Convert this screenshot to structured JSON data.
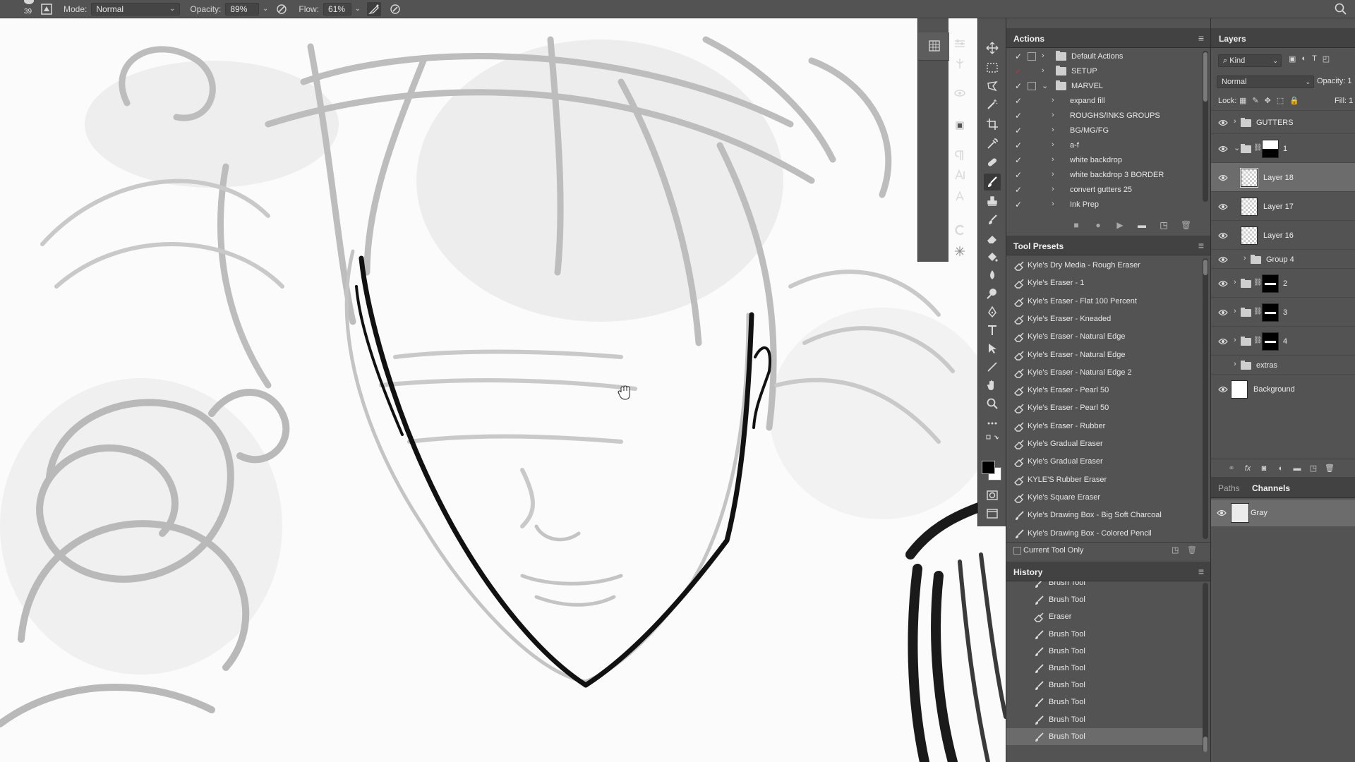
{
  "options_bar": {
    "brush_size": "39",
    "mode_label": "Mode:",
    "mode_value": "Normal",
    "opacity_label": "Opacity:",
    "opacity_value": "89%",
    "flow_label": "Flow:",
    "flow_value": "61%"
  },
  "actions_panel": {
    "title": "Actions",
    "items": [
      {
        "label": "Default Actions",
        "type": "set",
        "checked": true,
        "dialog": true,
        "expanded": false
      },
      {
        "label": "SETUP",
        "type": "set",
        "checked": true,
        "dialog": false,
        "expanded": false,
        "check_color": "#b43838"
      },
      {
        "label": "MARVEL",
        "type": "set",
        "checked": true,
        "dialog": true,
        "expanded": true
      },
      {
        "label": "expand fill",
        "type": "action",
        "checked": true
      },
      {
        "label": "ROUGHS/INKS GROUPS",
        "type": "action",
        "checked": true
      },
      {
        "label": "BG/MG/FG",
        "type": "action",
        "checked": true
      },
      {
        "label": "a-f",
        "type": "action",
        "checked": true
      },
      {
        "label": "white backdrop",
        "type": "action",
        "checked": true
      },
      {
        "label": "white backdrop 3 BORDER",
        "type": "action",
        "checked": true
      },
      {
        "label": "convert gutters 25",
        "type": "action",
        "checked": true
      },
      {
        "label": "Ink Prep",
        "type": "action",
        "checked": true
      }
    ]
  },
  "tool_presets_panel": {
    "title": "Tool Presets",
    "items": [
      "Kyle's Dry Media - Rough Eraser",
      "Kyle's Eraser - 1",
      "Kyle's Eraser - Flat 100 Percent",
      "Kyle's Eraser - Kneaded",
      "Kyle's Eraser - Natural Edge",
      "Kyle's Eraser - Natural Edge",
      "Kyle's Eraser - Natural Edge 2",
      "Kyle's Eraser - Pearl 50",
      "Kyle's Eraser - Pearl 50",
      "Kyle's Eraser - Rubber",
      "Kyle's Gradual Eraser",
      "Kyle's Gradual Eraser",
      "KYLE'S Rubber Eraser",
      "Kyle's Square Eraser",
      "Kyle's Drawing Box - Big Soft Charcoal",
      "Kyle's Drawing Box - Colored Pencil"
    ],
    "current_tool_only": "Current Tool Only"
  },
  "history_panel": {
    "title": "History",
    "items": [
      {
        "label": "Brush Tool",
        "icon": "brush-icon"
      },
      {
        "label": "Brush Tool",
        "icon": "brush-icon"
      },
      {
        "label": "Eraser",
        "icon": "eraser-icon"
      },
      {
        "label": "Brush Tool",
        "icon": "brush-icon"
      },
      {
        "label": "Brush Tool",
        "icon": "brush-icon"
      },
      {
        "label": "Brush Tool",
        "icon": "brush-icon"
      },
      {
        "label": "Brush Tool",
        "icon": "brush-icon"
      },
      {
        "label": "Brush Tool",
        "icon": "brush-icon"
      },
      {
        "label": "Brush Tool",
        "icon": "brush-icon"
      },
      {
        "label": "Brush Tool",
        "icon": "brush-icon",
        "active": true
      }
    ]
  },
  "layers_panel": {
    "title": "Layers",
    "filter_kind": "Kind",
    "blend_mode": "Normal",
    "opacity_label": "Opacity:",
    "opacity_value": "1",
    "lock_label": "Lock:",
    "fill_label": "Fill:",
    "fill_value": "1",
    "layers": [
      {
        "name": "GUTTERS",
        "type": "group",
        "visible": true
      },
      {
        "name": "1",
        "type": "group-mask",
        "visible": true,
        "expanded": true
      },
      {
        "name": "Layer 18",
        "type": "layer",
        "visible": true,
        "active": true
      },
      {
        "name": "Layer 17",
        "type": "layer",
        "visible": true
      },
      {
        "name": "Layer 16",
        "type": "layer",
        "visible": true
      },
      {
        "name": "Group 4",
        "type": "group",
        "visible": true
      },
      {
        "name": "2",
        "type": "group-mask",
        "visible": true
      },
      {
        "name": "3",
        "type": "group-mask",
        "visible": true
      },
      {
        "name": "4",
        "type": "group-mask",
        "visible": true
      },
      {
        "name": "extras",
        "type": "group",
        "visible": false
      },
      {
        "name": "Background",
        "type": "background",
        "visible": true
      }
    ]
  },
  "paths_channels": {
    "tab_paths": "Paths",
    "tab_channels": "Channels",
    "channel_name": "Gray"
  },
  "colors": {
    "panel_bg": "#535353",
    "panel_header": "#424242",
    "selected_row": "#6c6c6c",
    "foreground_color": "#000000",
    "background_color": "#ffffff"
  }
}
